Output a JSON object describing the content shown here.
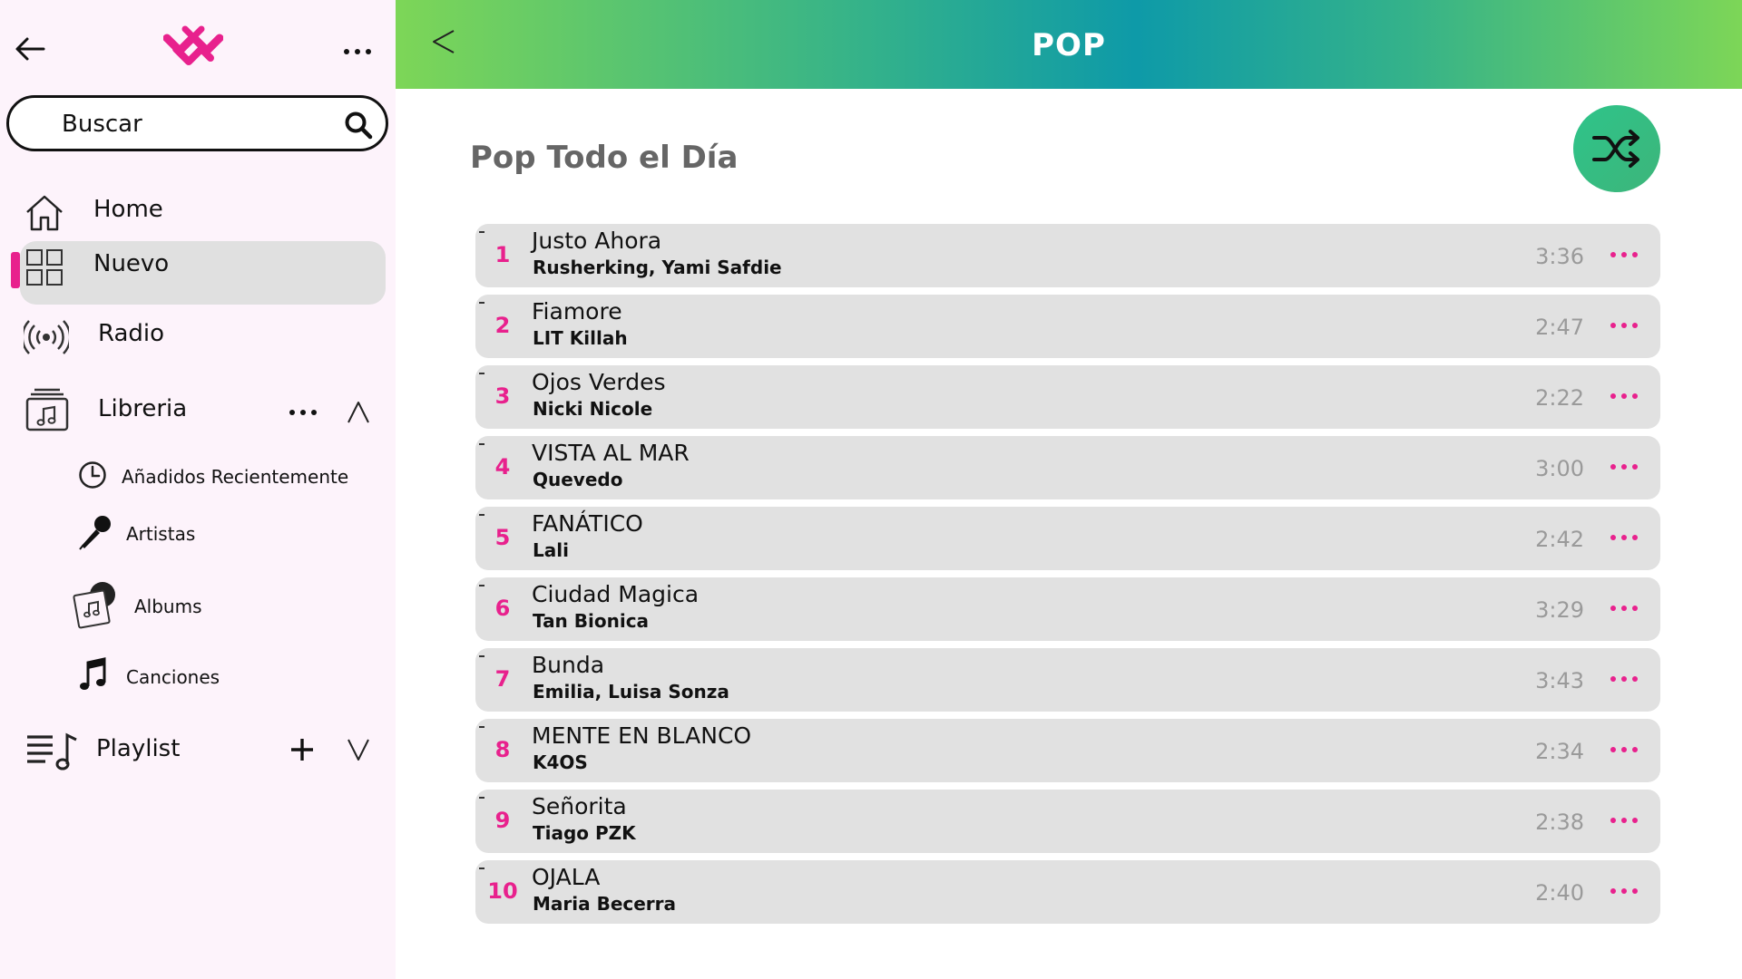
{
  "sidebar": {
    "search": {
      "placeholder": "Buscar"
    },
    "nav": {
      "home": "Home",
      "nuevo": "Nuevo",
      "radio": "Radio",
      "libreria": "Libreria",
      "playlist": "Playlist"
    },
    "library": {
      "recent": "Añadidos Recientemente",
      "artists": "Artistas",
      "albums": "Albums",
      "songs": "Canciones"
    },
    "active_item": "Nuevo",
    "accent_color": "#e8218d"
  },
  "header": {
    "title": "POP"
  },
  "playlist": {
    "name": "Pop Todo el Día",
    "tracks": [
      {
        "number": "1",
        "title": "Justo Ahora",
        "artist": "Rusherking, Yami Safdie",
        "duration": "3:36"
      },
      {
        "number": "2",
        "title": "Fiamore",
        "artist": "LIT Killah",
        "duration": "2:47"
      },
      {
        "number": "3",
        "title": "Ojos Verdes",
        "artist": "Nicki Nicole",
        "duration": "2:22"
      },
      {
        "number": "4",
        "title": "VISTA AL MAR",
        "artist": "Quevedo",
        "duration": "3:00"
      },
      {
        "number": "5",
        "title": "FANÁTICO",
        "artist": "Lali",
        "duration": "2:42"
      },
      {
        "number": "6",
        "title": "Ciudad Magica",
        "artist": "Tan Bionica",
        "duration": "3:29"
      },
      {
        "number": "7",
        "title": "Bunda",
        "artist": "Emilia, Luisa Sonza",
        "duration": "3:43"
      },
      {
        "number": "8",
        "title": "MENTE EN BLANCO",
        "artist": "K4OS",
        "duration": "2:34"
      },
      {
        "number": "9",
        "title": "Señorita",
        "artist": "Tiago PZK",
        "duration": "2:38"
      },
      {
        "number": "10",
        "title": "OJALA",
        "artist": "Maria Becerra",
        "duration": "2:40"
      }
    ]
  }
}
